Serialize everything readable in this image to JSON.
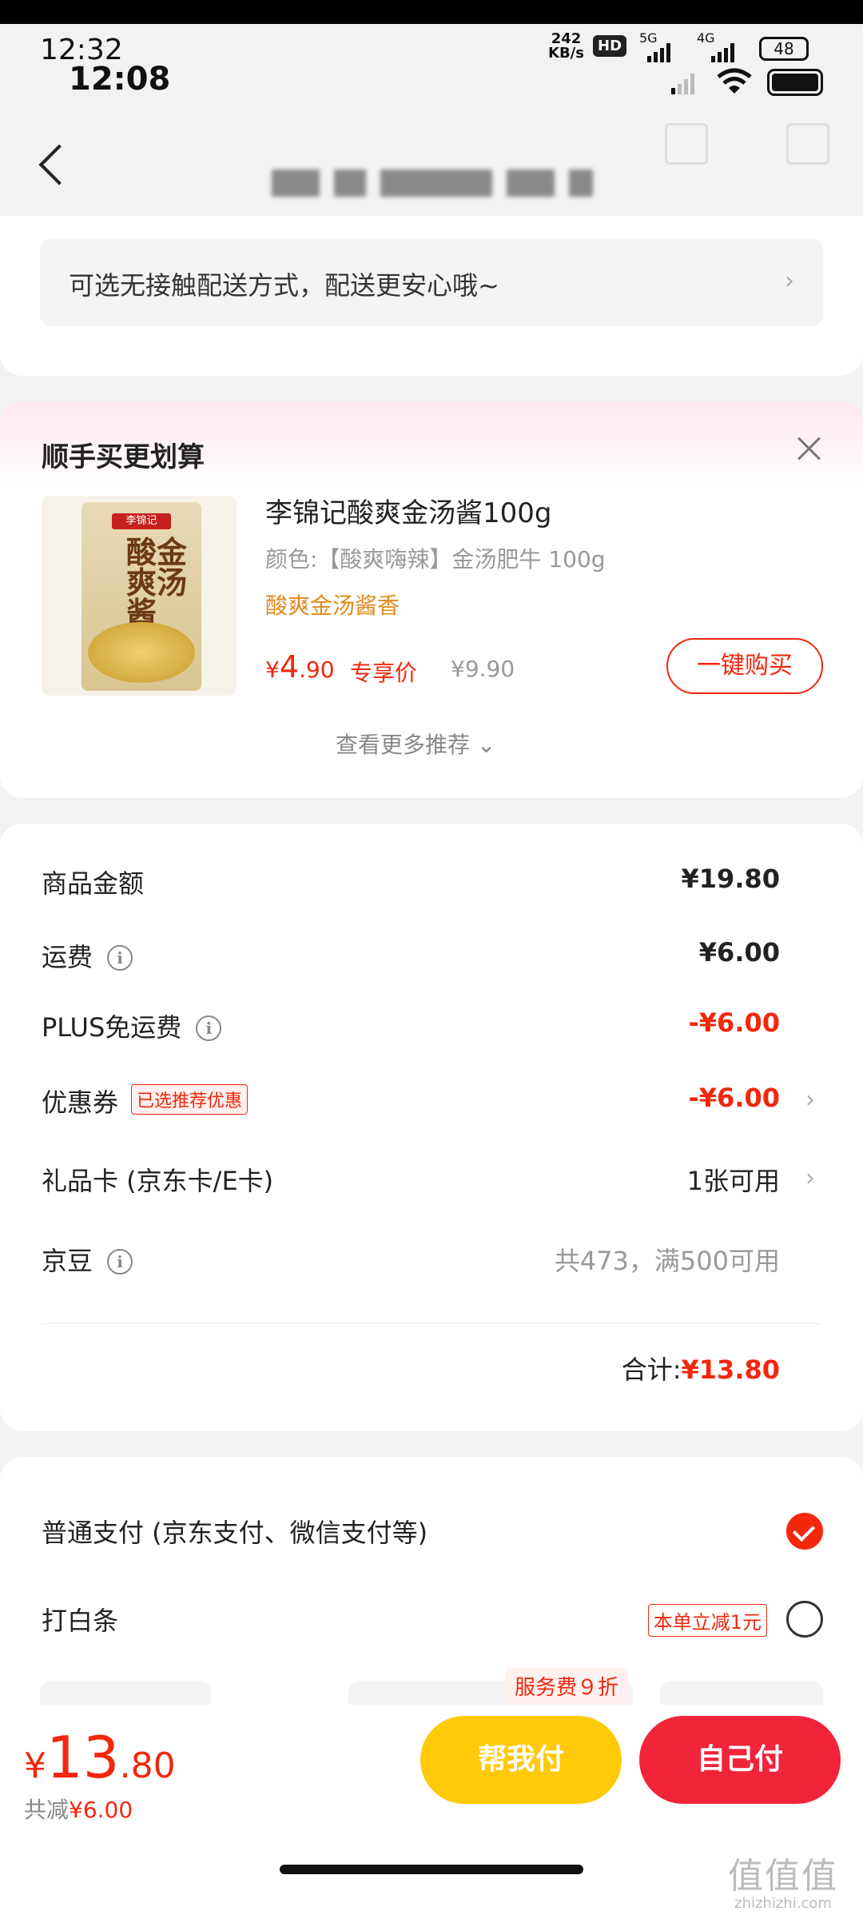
{
  "status_bar": {
    "time_primary": "12:32",
    "time_secondary": "12:08",
    "net_speed_value": "242",
    "net_speed_unit": "KB/s",
    "hd_badge": "HD",
    "sig1_label": "5G",
    "sig2_label": "4G",
    "battery_level": "48"
  },
  "header": {
    "back_icon": "chevron-left-icon",
    "title_blurred": true,
    "icons": [
      "download-icon",
      "share-icon"
    ]
  },
  "delivery": {
    "notice": "可选无接触配送方式，配送更安心哦~",
    "chevron": "›"
  },
  "recommend": {
    "title": "顺手买更划算",
    "product": {
      "name": "李锦记酸爽金汤酱100g",
      "spec": "颜色:【酸爽嗨辣】金汤肥牛 100g",
      "tag": "酸爽金汤酱香",
      "price_symbol": "¥",
      "price_int": "4",
      "price_dec": ".90",
      "price_label": "专享价",
      "original_price": "¥9.90",
      "buy_label": "一键购买",
      "package_brand": "李锦记",
      "package_name": "酸金爽汤酱"
    },
    "more_label": "查看更多推荐 ⌄"
  },
  "summary": {
    "rows": [
      {
        "label": "商品金额",
        "value": "¥19.80"
      },
      {
        "label": "运费",
        "value": "¥6.00"
      },
      {
        "label": "PLUS免运费",
        "value": "-¥6.00"
      },
      {
        "label": "优惠券",
        "badge": "已选推荐优惠",
        "value": "-¥6.00"
      },
      {
        "label": "礼品卡 (京东卡/E卡)",
        "value": "1张可用"
      },
      {
        "label": "京豆",
        "value": "共473，满500可用"
      }
    ],
    "info_glyph": "i",
    "chevron": "›",
    "total_label": "合计:",
    "total_value": "¥13.80"
  },
  "payment": {
    "options": [
      {
        "label": "普通支付 (京东支付、微信支付等)",
        "selected": true
      },
      {
        "label": "打白条",
        "badge": "本单立减1元",
        "selected": false
      }
    ],
    "service_badge": "服务费９折"
  },
  "bottom": {
    "price_symbol": "¥",
    "price_int": "13",
    "price_dec": ".80",
    "saved_label": "共减",
    "saved_value": "¥6.00",
    "help_pay": "帮我付",
    "self_pay": "自己付"
  },
  "watermark": {
    "logo": "值值值",
    "url": "zhizhizhi.com"
  },
  "colors": {
    "accent_red": "#f2270c",
    "pay_red": "#f2243a",
    "help_yellow": "#ffca0a",
    "tag_orange": "#e08a1f"
  }
}
